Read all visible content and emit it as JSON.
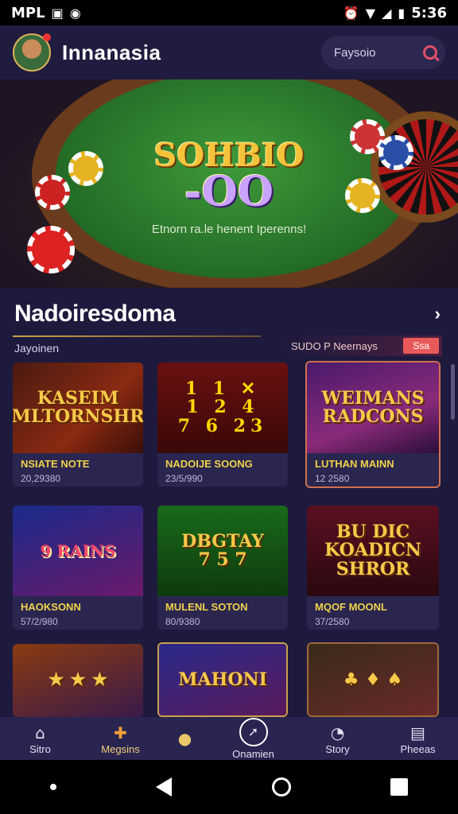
{
  "status_bar": {
    "carrier": "MPL",
    "time": "5:36",
    "left_icons": [
      "gallery-icon",
      "record-icon"
    ],
    "right_icons": [
      "alarm-icon",
      "wifi-icon",
      "signal-icon",
      "battery-icon"
    ]
  },
  "app_bar": {
    "title": "Innanasia",
    "search_placeholder": "Faysoio"
  },
  "hero": {
    "logo_line1": "SOHBIO",
    "logo_line2": "-OO",
    "caption": "Etnorn ra.le henent Iperenns!"
  },
  "section": {
    "title": "Nadoiresdoma",
    "subtitle": "Jayoinen",
    "promo_text": "SUDO P Neernays",
    "promo_button": "Ssa"
  },
  "cards": [
    {
      "thumb": "KASEIM\nMLTORNSHR",
      "name": "NSIATE NOTE",
      "sub": "20,29380"
    },
    {
      "thumb": "1 1 ✕\n1 2 4\n7 6 23",
      "name": "NADOIJE SOONG",
      "sub": "23/5/990"
    },
    {
      "thumb": "WEIMANS\nRADCONS",
      "name": "LUTHAN MAINN",
      "sub": "12 2580"
    },
    {
      "thumb": "9 RAINS",
      "name": "HAOKSONN",
      "sub": "57/2/980"
    },
    {
      "thumb": "DBGTAY\n7 5 7",
      "name": "MULENL SOTON",
      "sub": "80/9380"
    },
    {
      "thumb": "BU DIC\nKOADICN\nSHROR",
      "name": "MQOF MOONL",
      "sub": "37/2580"
    },
    {
      "thumb": "★ ★ ★",
      "name": "",
      "sub": ""
    },
    {
      "thumb": "MAHONI",
      "name": "",
      "sub": ""
    },
    {
      "thumb": "♣ ♦ ♠",
      "name": "",
      "sub": ""
    }
  ],
  "bottom_nav": [
    {
      "label": "Sitro",
      "icon": "home-icon"
    },
    {
      "label": "Megsins",
      "icon": "puzzle-icon"
    },
    {
      "label": "",
      "icon": "location-icon"
    },
    {
      "label": "Onamien",
      "icon": "play-icon"
    },
    {
      "label": "Story",
      "icon": "timer-icon"
    },
    {
      "label": "Pheeas",
      "icon": "profile-icon"
    }
  ],
  "colors": {
    "accent": "#f1d27a",
    "background": "#1e1a3e",
    "promo_button": "#e85a5a"
  }
}
